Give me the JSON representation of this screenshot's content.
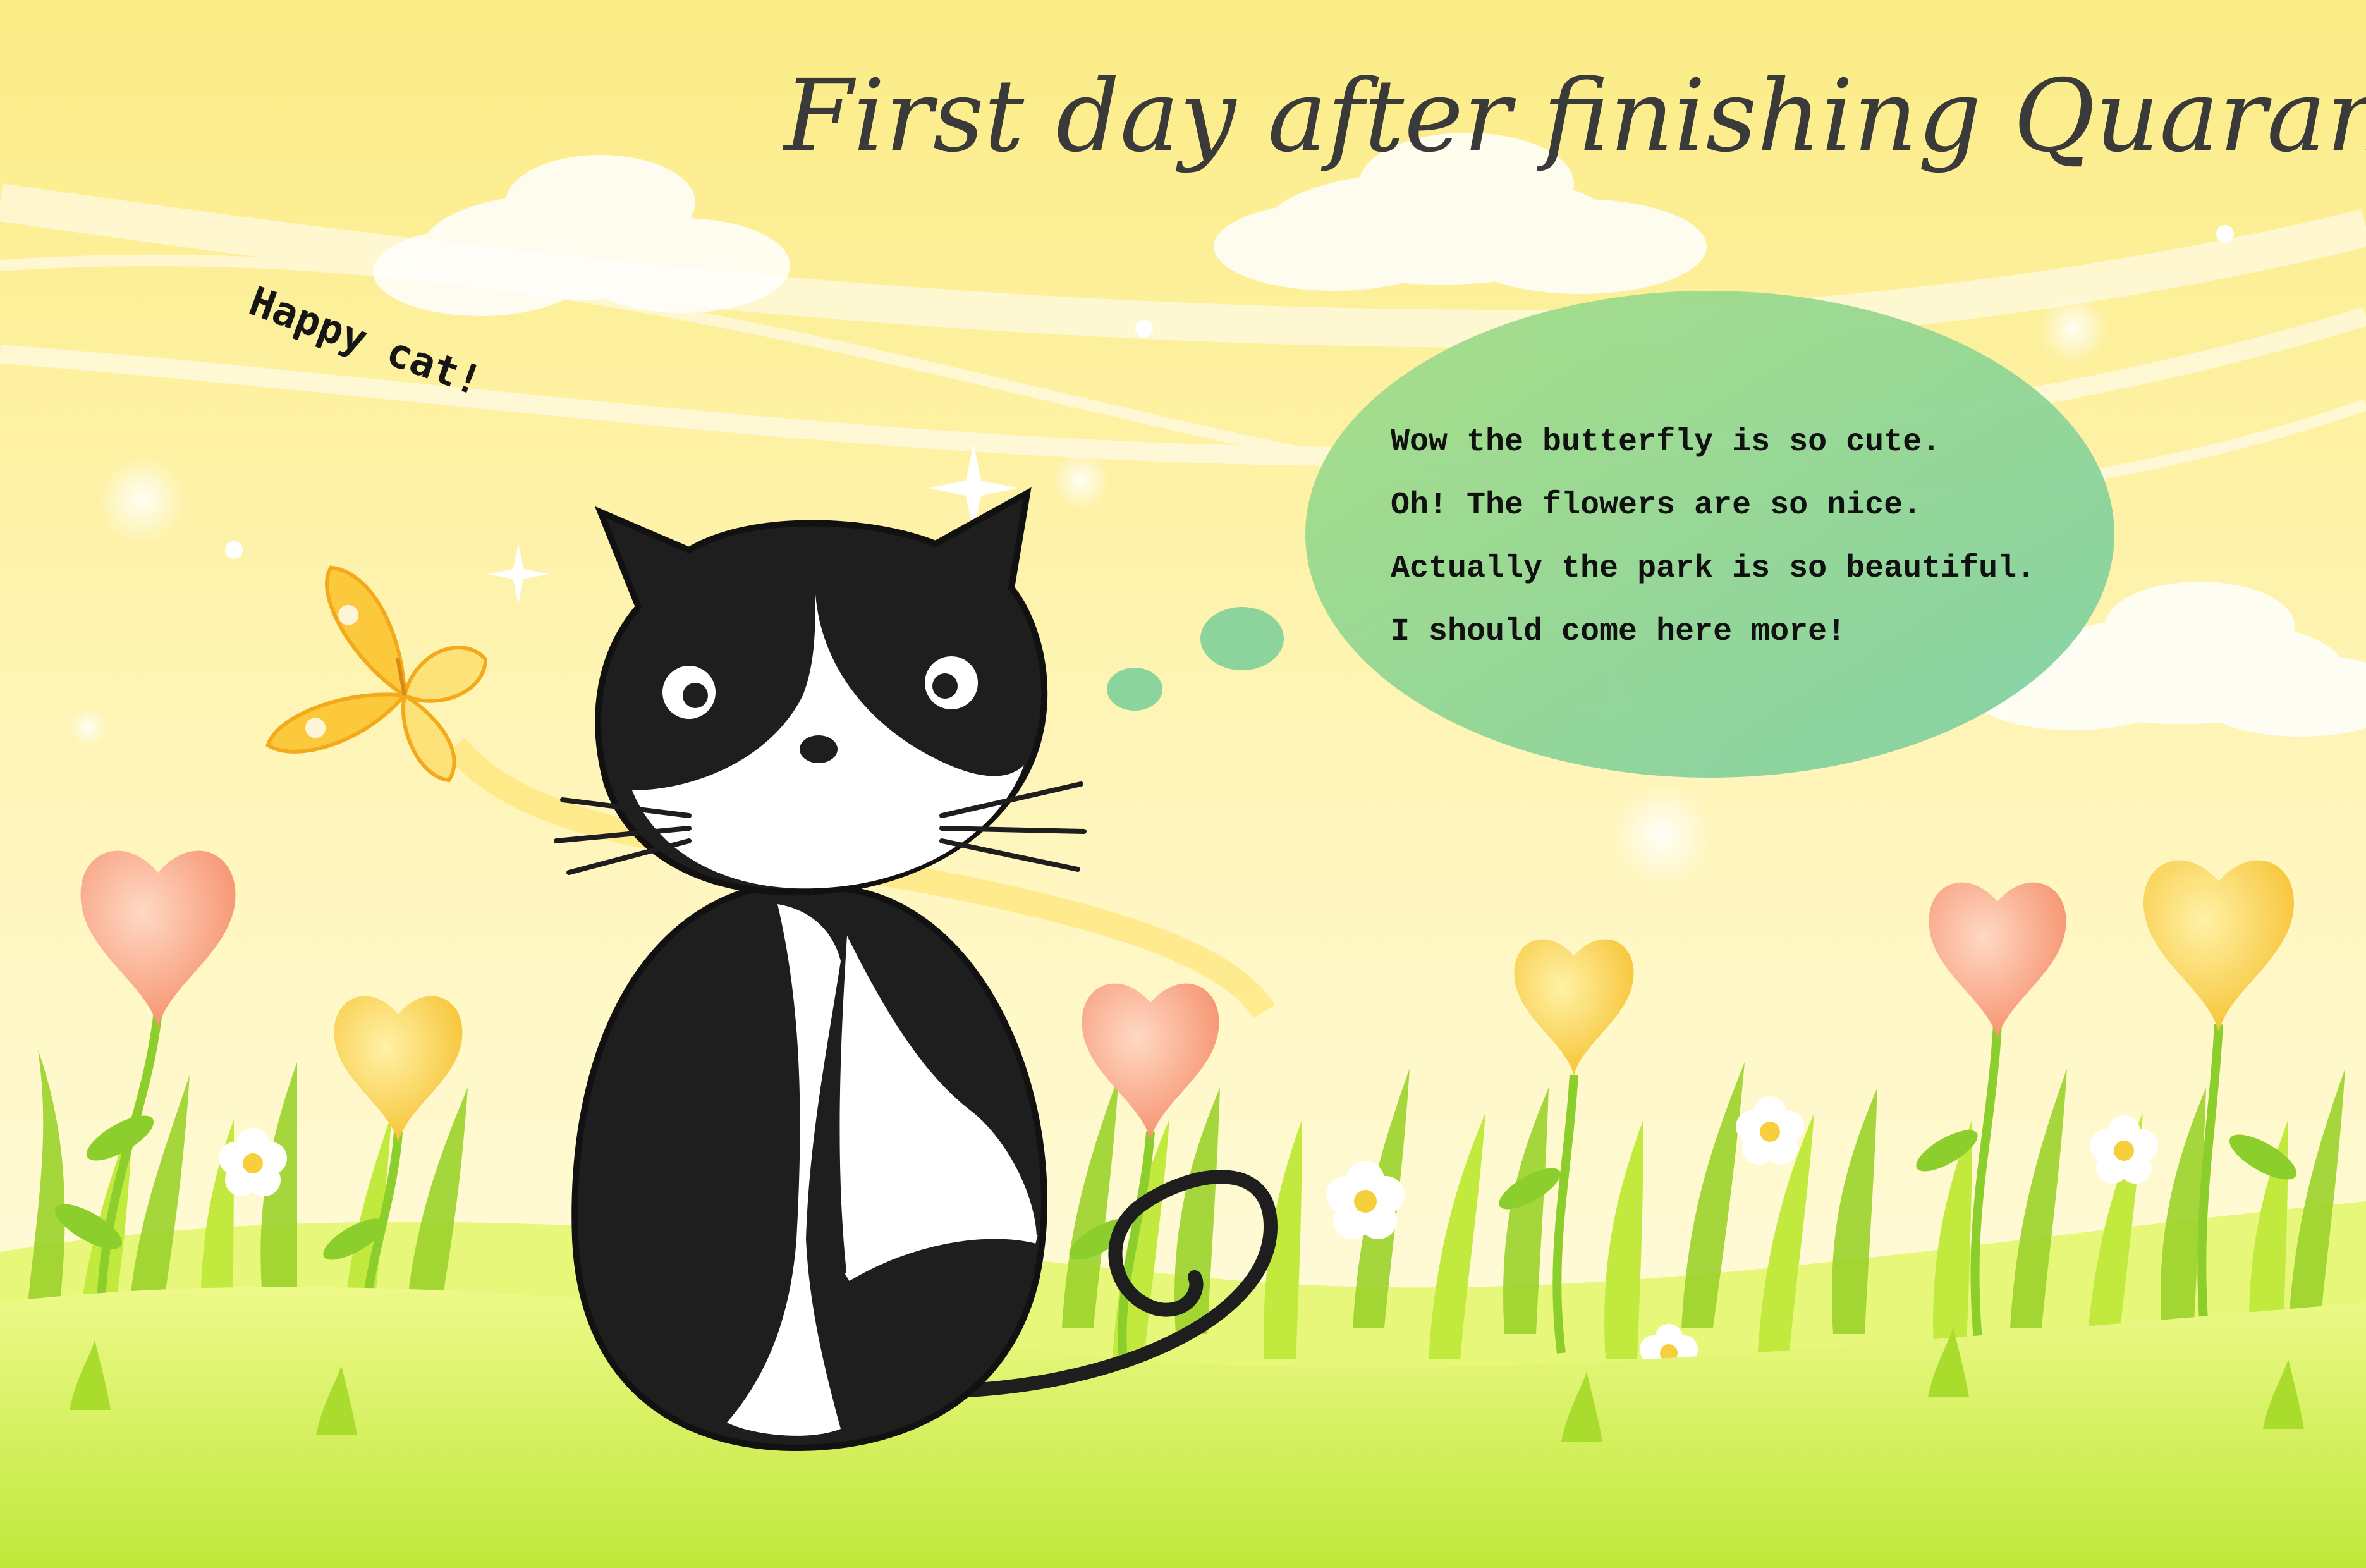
{
  "title": "First day after finishing Quarantine",
  "caption": "Happy cat!",
  "speech_bubble": {
    "lines": [
      "Wow the butterfly is so cute.",
      "Oh! The flowers are so nice.",
      "Actually the park is so beautiful.",
      "I should come here more!"
    ]
  },
  "icons": [
    "cat-icon",
    "butterfly-icon",
    "heart-flower-icon",
    "daisy-icon",
    "cloud-icon",
    "sparkle-icon"
  ],
  "colors": {
    "sky_top": "#fcee8a",
    "sky_bottom": "#fffbd6",
    "grass": "#c8ec4a",
    "grass_dark": "#9bd12b",
    "bubble": "#8fd49a",
    "cat_black": "#1e1e1e",
    "heart_pink": "#f7a07f",
    "heart_yellow": "#fbd24a",
    "title_text": "#3a3a3a"
  }
}
